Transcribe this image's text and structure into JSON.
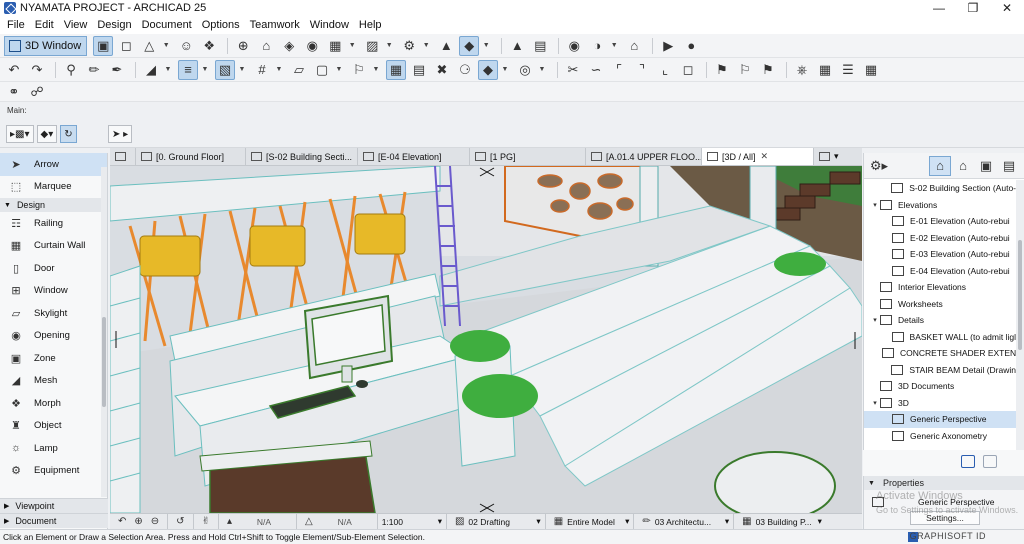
{
  "window": {
    "title": "NYAMATA PROJECT - ARCHICAD 25",
    "min": "—",
    "max": "❐",
    "close": "✕"
  },
  "menu": [
    "File",
    "Edit",
    "View",
    "Design",
    "Document",
    "Options",
    "Teamwork",
    "Window",
    "Help"
  ],
  "toolbar": {
    "view3d_label": "3D Window"
  },
  "infobox": {
    "label": "Main:"
  },
  "toolbox": {
    "select_tools": [
      {
        "label": "Arrow",
        "icon": "arrow-icon"
      },
      {
        "label": "Marquee",
        "icon": "marquee-icon"
      }
    ],
    "design_label": "Design",
    "design_tools": [
      {
        "label": "Railing",
        "icon": "railing-icon"
      },
      {
        "label": "Curtain Wall",
        "icon": "curtain-wall-icon"
      },
      {
        "label": "Door",
        "icon": "door-icon"
      },
      {
        "label": "Window",
        "icon": "window-icon"
      },
      {
        "label": "Skylight",
        "icon": "skylight-icon"
      },
      {
        "label": "Opening",
        "icon": "opening-icon"
      },
      {
        "label": "Zone",
        "icon": "zone-icon"
      },
      {
        "label": "Mesh",
        "icon": "mesh-icon"
      },
      {
        "label": "Morph",
        "icon": "morph-icon"
      },
      {
        "label": "Object",
        "icon": "object-icon"
      },
      {
        "label": "Lamp",
        "icon": "lamp-icon"
      },
      {
        "label": "Equipment",
        "icon": "equipment-icon"
      }
    ],
    "viewpoint_label": "Viewpoint",
    "document_label": "Document"
  },
  "tabs": [
    {
      "label": "[0. Ground Floor]",
      "icon": "floor-plan-icon"
    },
    {
      "label": "[S-02 Building Secti...",
      "icon": "section-icon"
    },
    {
      "label": "[E-04 Elevation]",
      "icon": "elevation-icon"
    },
    {
      "label": "[1 PG]",
      "icon": "layout-icon"
    },
    {
      "label": "[A.01.4 UPPER FLOO...",
      "icon": "layout-icon"
    },
    {
      "label": "[3D / All]",
      "icon": "3d-icon",
      "close": "✕"
    }
  ],
  "viewstatus": {
    "na1": "N/A",
    "na2": "N/A",
    "scale": "1:100",
    "layer": "02 Drafting",
    "model": "Entire Model",
    "pen": "03 Architectu...",
    "override": "03 Building P..."
  },
  "navigator": {
    "items": [
      {
        "label": "S-02 Building Section (Auto-",
        "level": 2,
        "tri": ""
      },
      {
        "label": "Elevations",
        "level": 1,
        "tri": "▾"
      },
      {
        "label": "E-01 Elevation (Auto-rebui",
        "level": 2,
        "tri": ""
      },
      {
        "label": "E-02 Elevation (Auto-rebui",
        "level": 2,
        "tri": ""
      },
      {
        "label": "E-03 Elevation (Auto-rebui",
        "level": 2,
        "tri": ""
      },
      {
        "label": "E-04 Elevation (Auto-rebui",
        "level": 2,
        "tri": ""
      },
      {
        "label": "Interior Elevations",
        "level": 1,
        "tri": ""
      },
      {
        "label": "Worksheets",
        "level": 1,
        "tri": ""
      },
      {
        "label": "Details",
        "level": 1,
        "tri": "▾"
      },
      {
        "label": "BASKET WALL (to admit ligl",
        "level": 2,
        "tri": ""
      },
      {
        "label": "CONCRETE SHADER EXTEN",
        "level": 2,
        "tri": ""
      },
      {
        "label": "STAIR BEAM Detail (Drawin",
        "level": 2,
        "tri": ""
      },
      {
        "label": "3D Documents",
        "level": 1,
        "tri": ""
      },
      {
        "label": "3D",
        "level": 1,
        "tri": "▾"
      },
      {
        "label": "Generic Perspective",
        "level": 2,
        "tri": "",
        "selected": true
      },
      {
        "label": "Generic Axonometry",
        "level": 2,
        "tri": ""
      }
    ]
  },
  "properties": {
    "header": "Properties",
    "name": "Generic Perspective",
    "settings_label": "Settings..."
  },
  "watermark": {
    "line1": "Activate Windows",
    "line2": "Go to Settings to activate Windows."
  },
  "status": {
    "hint": "Click an Element or Draw a Selection Area. Press and Hold Ctrl+Shift to Toggle Element/Sub-Element Selection.",
    "graphisoft": "GRAPHISOFT ID"
  },
  "colors": {
    "accent": "#2a5db0",
    "selected": "#cfe1f4",
    "viewport_bg": "#d9dde2"
  }
}
